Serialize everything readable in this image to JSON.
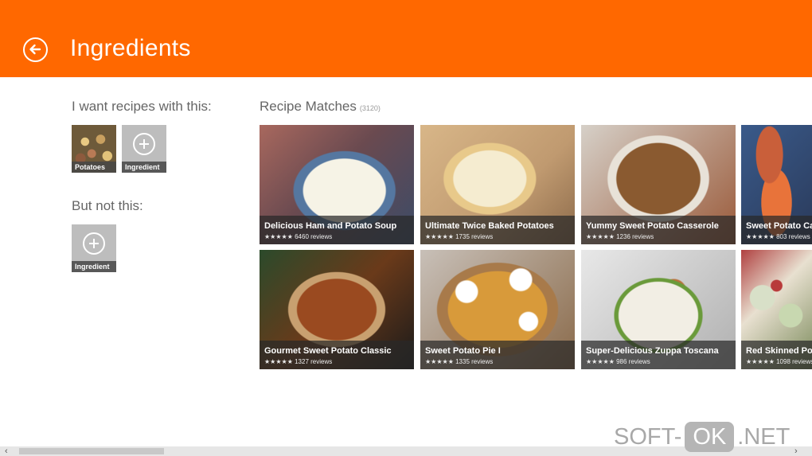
{
  "header": {
    "title": "Ingredients",
    "back_icon": "back-arrow-icon",
    "color": "#ff6800"
  },
  "include": {
    "label": "I want recipes with this:",
    "chips": [
      {
        "label": "Potatoes"
      },
      {
        "label": "Ingredient"
      }
    ]
  },
  "exclude": {
    "label": "But not this:",
    "chips": [
      {
        "label": "Ingredient"
      }
    ]
  },
  "matches": {
    "title": "Recipe Matches",
    "count": "(3120)",
    "recipes": [
      {
        "name": "Delicious Ham and Potato Soup",
        "stars": "★★★★★",
        "reviews": "6460 reviews"
      },
      {
        "name": "Ultimate Twice Baked Potatoes",
        "stars": "★★★★★",
        "reviews": "1735 reviews"
      },
      {
        "name": "Yummy Sweet Potato Casserole",
        "stars": "★★★★★",
        "reviews": "1236 reviews"
      },
      {
        "name": "Sweet Potato Cas",
        "stars": "★★★★★",
        "reviews": "803 reviews"
      },
      {
        "name": "Gourmet Sweet Potato Classic",
        "stars": "★★★★★",
        "reviews": "1327 reviews"
      },
      {
        "name": "Sweet Potato Pie I",
        "stars": "★★★★★",
        "reviews": "1335 reviews"
      },
      {
        "name": "Super-Delicious Zuppa Toscana",
        "stars": "★★★★★",
        "reviews": "986 reviews"
      },
      {
        "name": "Red Skinned Pota",
        "stars": "★★★★★",
        "reviews": "1098 reviews"
      }
    ]
  },
  "scrollbar": {
    "left_arrow": "‹",
    "right_arrow": "›"
  },
  "watermark": {
    "part1": "SOFT-",
    "part2": "OK",
    "part3": ".NET"
  }
}
